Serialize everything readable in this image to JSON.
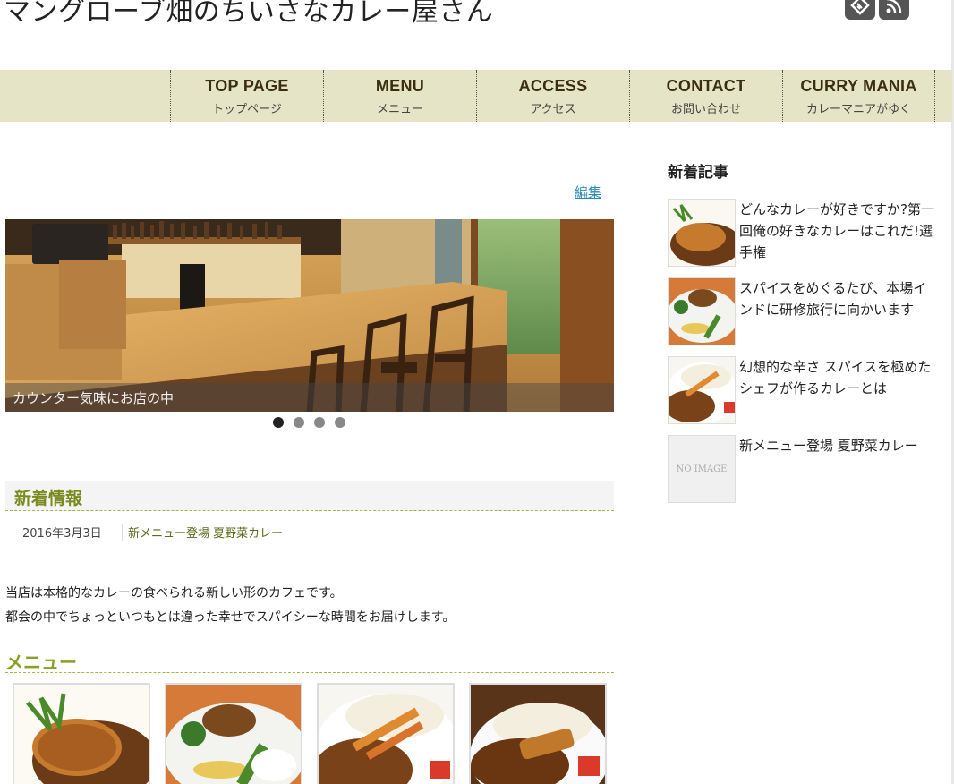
{
  "site": {
    "title": "マングローブ畑のちいさなカレー屋さん"
  },
  "social": {
    "feedly_icon": "feedly-icon",
    "rss_icon": "rss-icon"
  },
  "nav": [
    {
      "en": "TOP PAGE",
      "jp": "トップページ"
    },
    {
      "en": "MENU",
      "jp": "メニュー"
    },
    {
      "en": "ACCESS",
      "jp": "アクセス"
    },
    {
      "en": "CONTACT",
      "jp": "お問い合わせ"
    },
    {
      "en": "CURRY MANIA",
      "jp": "カレーマニアがゆく"
    }
  ],
  "main": {
    "edit_label": "編集",
    "slider": {
      "caption": "カウンター気味にお店の中",
      "slide_count": 4,
      "active_slide": 1
    },
    "news": {
      "heading": "新着情報",
      "date": "2016年3月3日",
      "link": "新メニュー登場 夏野菜カレー"
    },
    "intro": [
      "当店は本格的なカレーの食べられる新しい形のカフェです。",
      "都会の中でちょっといつもとは違った幸せでスパイシーな時間をお届けします。"
    ],
    "menu": {
      "heading": "メニュー"
    }
  },
  "sidebar": {
    "heading": "新着記事",
    "items": [
      {
        "text": "どんなカレーが好きですか?第一回俺の好きなカレーはこれだ!選手権"
      },
      {
        "text": "スパイスをめぐるたび、本場インドに研修旅行に向かいます"
      },
      {
        "text": "幻想的な辛さ スパイスを極めたシェフが作るカレーとは"
      },
      {
        "text": "新メニュー登場 夏野菜カレー",
        "noimage": "NO IMAGE"
      }
    ]
  }
}
